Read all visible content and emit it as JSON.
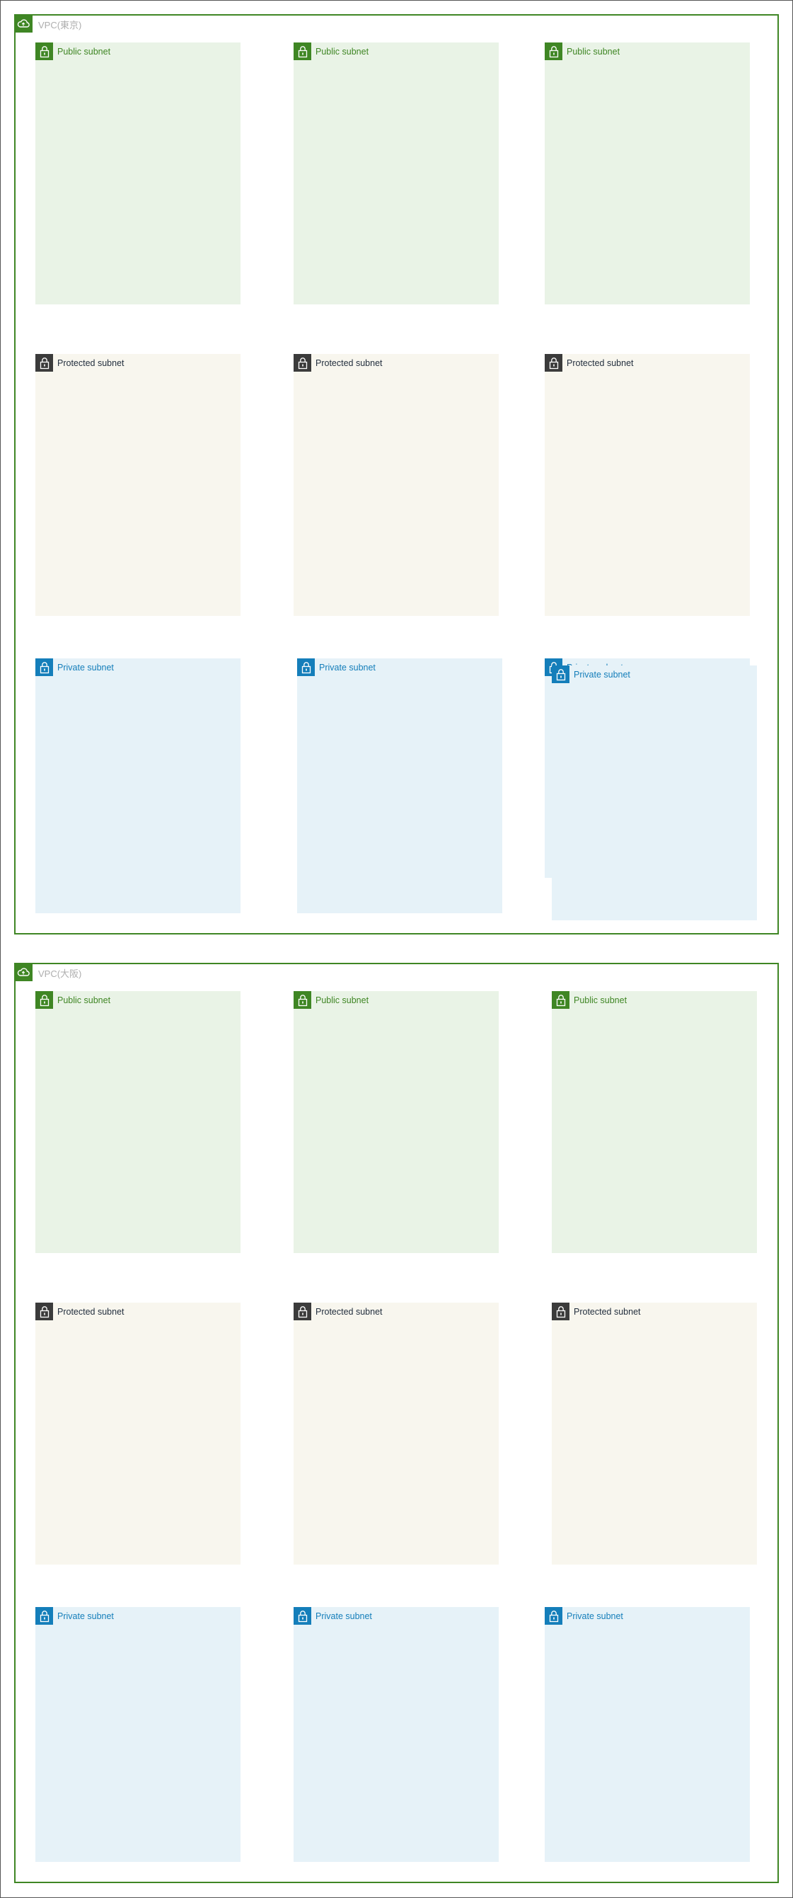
{
  "vpcs": [
    {
      "label": "VPC(東京)",
      "icon": "vpc-cloud-icon",
      "subnets": [
        {
          "type": "public",
          "label": "Public subnet",
          "icon": "lock-icon"
        },
        {
          "type": "public",
          "label": "Public subnet",
          "icon": "lock-icon"
        },
        {
          "type": "public",
          "label": "Public subnet",
          "icon": "lock-icon"
        },
        {
          "type": "protected",
          "label": "Protected subnet",
          "icon": "lock-icon"
        },
        {
          "type": "protected",
          "label": "Protected subnet",
          "icon": "lock-icon"
        },
        {
          "type": "protected",
          "label": "Protected subnet",
          "icon": "lock-icon"
        },
        {
          "type": "private",
          "label": "Private subnet",
          "icon": "lock-icon"
        },
        {
          "type": "private",
          "label": "Private subnet",
          "icon": "lock-icon"
        },
        {
          "type": "private",
          "label": "Private subnet",
          "icon": "lock-icon"
        },
        {
          "type": "private",
          "label": "Private subnet",
          "icon": "lock-icon"
        }
      ]
    },
    {
      "label": "VPC(大阪)",
      "icon": "vpc-cloud-icon",
      "subnets": [
        {
          "type": "public",
          "label": "Public subnet",
          "icon": "lock-icon"
        },
        {
          "type": "public",
          "label": "Public subnet",
          "icon": "lock-icon"
        },
        {
          "type": "public",
          "label": "Public subnet",
          "icon": "lock-icon"
        },
        {
          "type": "protected",
          "label": "Protected subnet",
          "icon": "lock-icon"
        },
        {
          "type": "protected",
          "label": "Protected subnet",
          "icon": "lock-icon"
        },
        {
          "type": "protected",
          "label": "Protected subnet",
          "icon": "lock-icon"
        },
        {
          "type": "private",
          "label": "Private subnet",
          "icon": "lock-icon"
        },
        {
          "type": "private",
          "label": "Private subnet",
          "icon": "lock-icon"
        },
        {
          "type": "private",
          "label": "Private subnet",
          "icon": "lock-icon"
        }
      ]
    }
  ],
  "colors": {
    "vpc_border": "#3f8624",
    "public_fill": "#e9f3e6",
    "protected_fill": "#f8f6ee",
    "private_fill": "#e6f2f8",
    "public_accent": "#3f8624",
    "protected_accent": "#3b3b3b",
    "private_accent": "#147eba"
  }
}
